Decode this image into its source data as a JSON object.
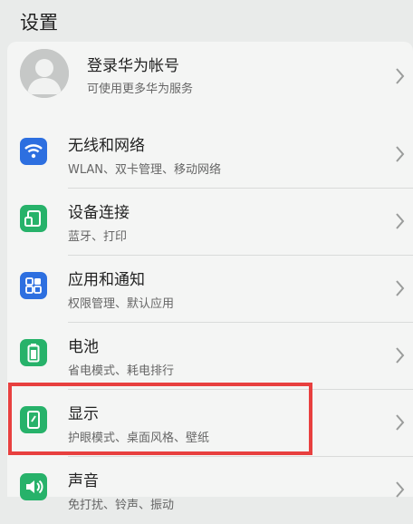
{
  "header": {
    "title": "设置"
  },
  "account": {
    "title": "登录华为帐号",
    "subtitle": "可使用更多华为服务"
  },
  "items": [
    {
      "label": "无线和网络",
      "sub": "WLAN、双卡管理、移动网络",
      "icon": "wifi-icon",
      "color": "#2d6fe0"
    },
    {
      "label": "设备连接",
      "sub": "蓝牙、打印",
      "icon": "device-connect-icon",
      "color": "#27b26a"
    },
    {
      "label": "应用和通知",
      "sub": "权限管理、默认应用",
      "icon": "apps-grid-icon",
      "color": "#2d6fe0"
    },
    {
      "label": "电池",
      "sub": "省电模式、耗电排行",
      "icon": "battery-icon",
      "color": "#27b26a"
    },
    {
      "label": "显示",
      "sub": "护眼模式、桌面风格、壁纸",
      "icon": "display-icon",
      "color": "#27b26a"
    },
    {
      "label": "声音",
      "sub": "免打扰、铃声、振动",
      "icon": "speaker-icon",
      "color": "#27b26a"
    }
  ],
  "highlight_color": "#e8403f"
}
